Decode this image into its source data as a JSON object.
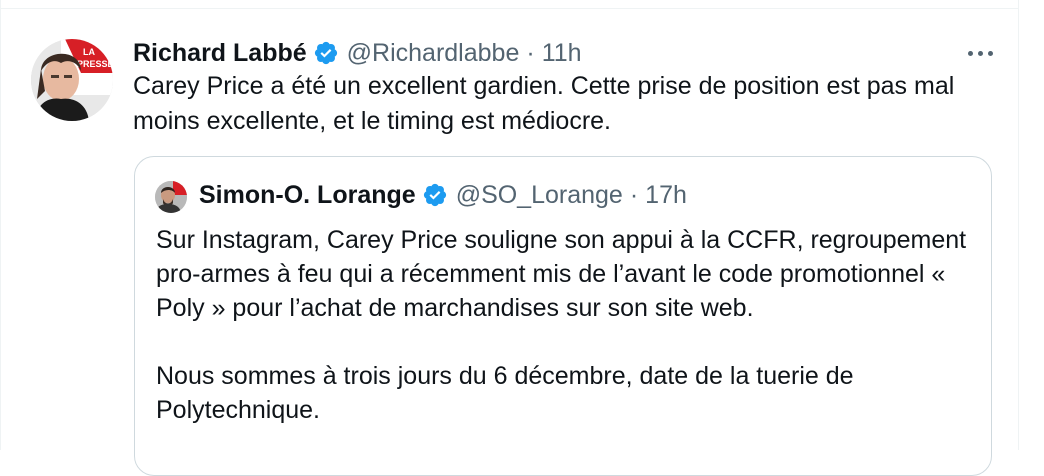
{
  "tweet": {
    "author_name": "Richard Labbé",
    "handle": "@Richardlabbe",
    "separator": "·",
    "time": "11h",
    "text": "Carey Price a été un excellent gardien. Cette prise de position est pas mal moins excellente, et le timing est médiocre.",
    "avatar_badge": "LA PRESSE"
  },
  "quoted_tweet": {
    "author_name": "Simon-O. Lorange",
    "handle": "@SO_Lorange",
    "separator": "·",
    "time": "17h",
    "paragraphs": [
      "Sur Instagram, Carey Price souligne son appui à la CCFR, regroupement pro-armes à feu qui a récemment mis de l’avant le code promotionnel « Poly » pour l’achat de marchandises sur son site web.",
      "Nous sommes à trois jours du 6 décembre, date de la tuerie de Polytechnique."
    ]
  },
  "colors": {
    "text_primary": "#0f1419",
    "text_secondary": "#536471",
    "verified_blue": "#1d9bf0",
    "border": "#cfd9de",
    "badge_red": "#d71f26"
  },
  "icons": {
    "verified": "verified-badge-icon",
    "more": "more-options-icon"
  }
}
